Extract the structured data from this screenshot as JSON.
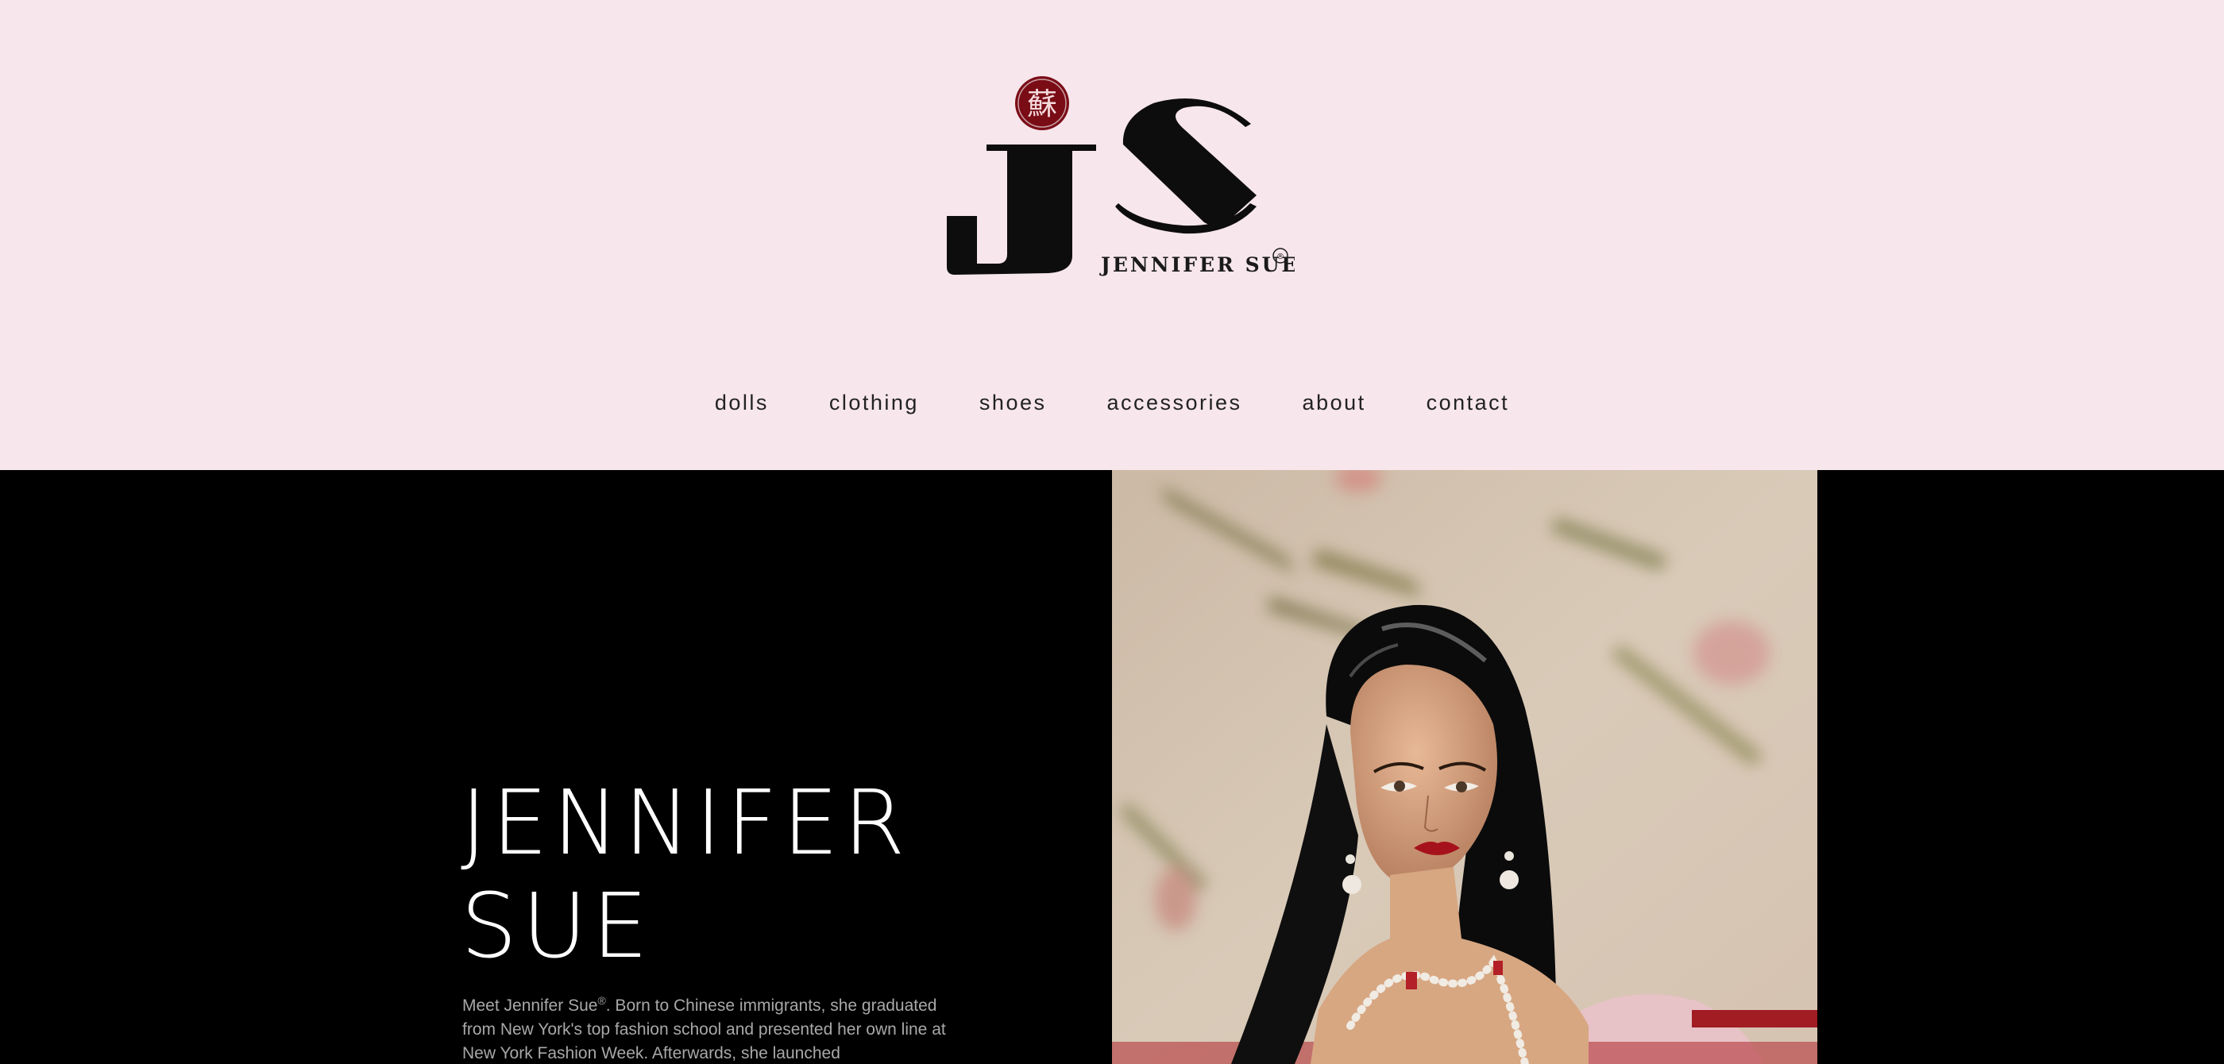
{
  "brand": {
    "logo_text": "JENNIFER SUE",
    "logo_mark": "JS",
    "seal_text": "蘇",
    "registered_symbol": "®",
    "colors": {
      "header_bg": "#f7e6ec",
      "seal_red": "#7a0c16",
      "ink": "#111111"
    }
  },
  "nav": {
    "items": [
      {
        "label": "dolls"
      },
      {
        "label": "clothing"
      },
      {
        "label": "shoes"
      },
      {
        "label": "accessories"
      },
      {
        "label": "about"
      },
      {
        "label": "contact"
      }
    ]
  },
  "hero": {
    "title_line1": "JENNIFER",
    "title_line2": "SUE",
    "intro_before": "Meet Jennifer Sue",
    "intro_sup": "®",
    "intro_after": ". Born to Chinese immigrants, she graduated from New York's top fashion school and presented her own line at New York Fashion Week. Afterwards, she launched",
    "image_icon": "doll-portrait-photo"
  }
}
